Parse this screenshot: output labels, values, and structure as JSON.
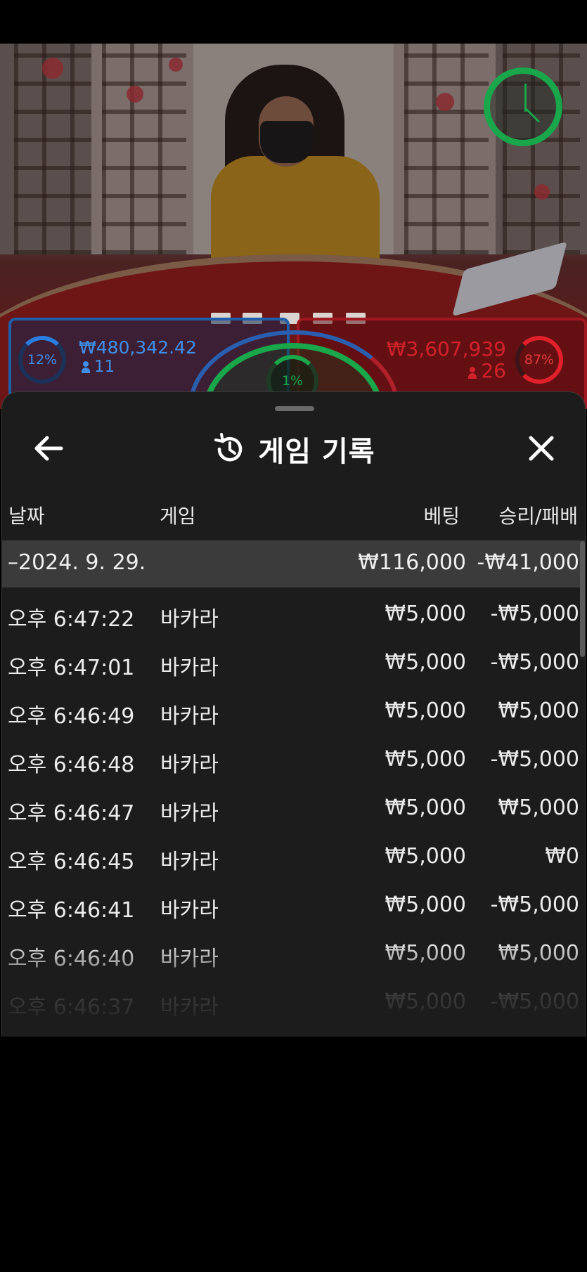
{
  "live_table": {
    "player": {
      "percent": "12%",
      "amount": "₩480,342.42",
      "count": "11"
    },
    "banker": {
      "percent": "87%",
      "amount": "₩3,607,939",
      "count": "26"
    },
    "tie": {
      "percent": "1%"
    },
    "timer_icon": "clock-icon"
  },
  "history": {
    "title": "게임 기록",
    "title_icon": "history-icon",
    "back_icon": "arrow-left-icon",
    "close_icon": "close-icon",
    "columns": {
      "date": "날짜",
      "game": "게임",
      "bet": "베팅",
      "result": "승리/패배"
    },
    "date_group": {
      "label": "–2024. 9. 29.",
      "bet_total": "₩116,000",
      "result_total": "-₩41,000"
    },
    "rows": [
      {
        "time": "오후 6:47:22",
        "game": "바카라",
        "bet": "₩5,000",
        "result": "-₩5,000"
      },
      {
        "time": "오후 6:47:01",
        "game": "바카라",
        "bet": "₩5,000",
        "result": "-₩5,000"
      },
      {
        "time": "오후 6:46:49",
        "game": "바카라",
        "bet": "₩5,000",
        "result": "₩5,000"
      },
      {
        "time": "오후 6:46:48",
        "game": "바카라",
        "bet": "₩5,000",
        "result": "-₩5,000"
      },
      {
        "time": "오후 6:46:47",
        "game": "바카라",
        "bet": "₩5,000",
        "result": "₩5,000"
      },
      {
        "time": "오후 6:46:45",
        "game": "바카라",
        "bet": "₩5,000",
        "result": "₩0"
      },
      {
        "time": "오후 6:46:41",
        "game": "바카라",
        "bet": "₩5,000",
        "result": "-₩5,000"
      },
      {
        "time": "오후 6:46:40",
        "game": "바카라",
        "bet": "₩5,000",
        "result": "₩5,000"
      },
      {
        "time": "오후 6:46:37",
        "game": "바카라",
        "bet": "₩5,000",
        "result": "-₩5,000"
      }
    ]
  }
}
